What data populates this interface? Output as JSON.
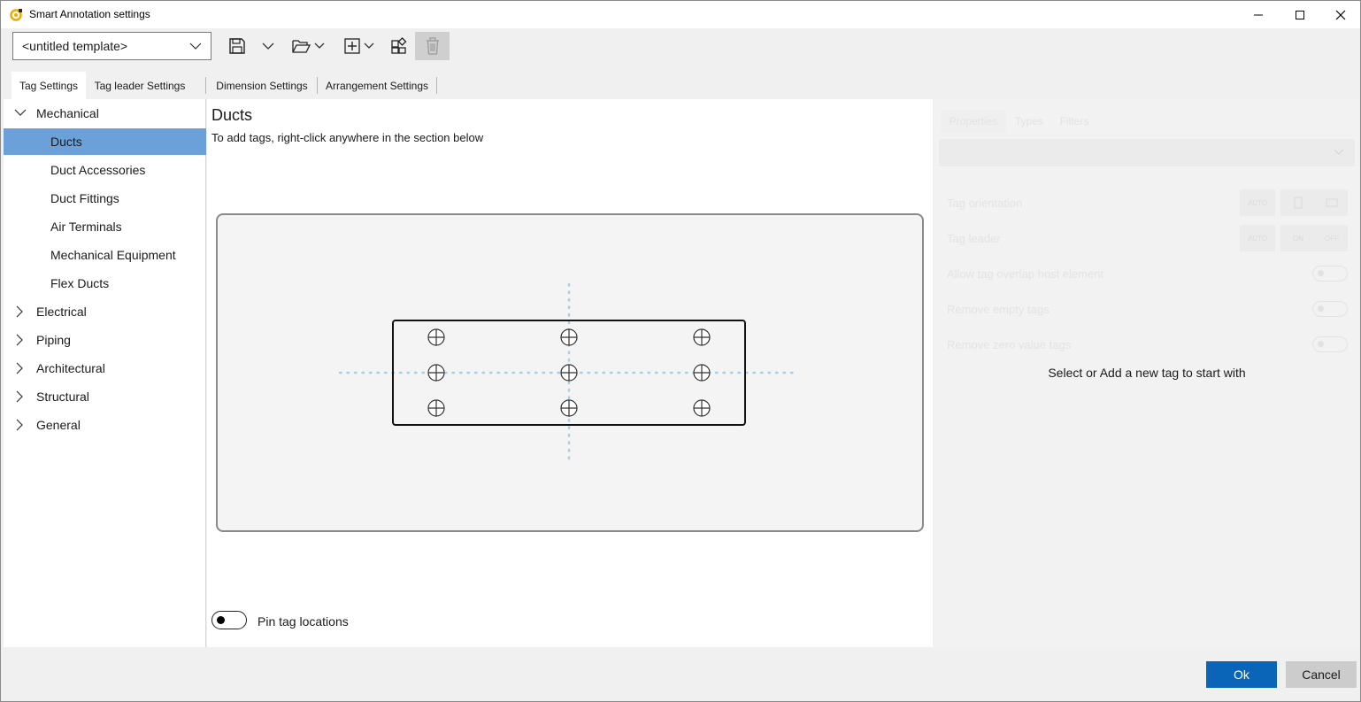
{
  "window": {
    "title": "Smart Annotation settings"
  },
  "toolbar": {
    "template_value": "<untitled template>"
  },
  "tabs": [
    {
      "label": "Tag Settings",
      "active": true
    },
    {
      "label": "Tag leader Settings",
      "active": false
    },
    {
      "label": "Dimension Settings",
      "active": false
    },
    {
      "label": "Arrangement Settings",
      "active": false
    }
  ],
  "tree": {
    "items": [
      {
        "label": "Mechanical",
        "expanded": true,
        "level": 0
      },
      {
        "label": "Ducts",
        "selected": true,
        "level": 1
      },
      {
        "label": "Duct Accessories",
        "level": 1
      },
      {
        "label": "Duct Fittings",
        "level": 1
      },
      {
        "label": "Air Terminals",
        "level": 1
      },
      {
        "label": "Mechanical Equipment",
        "level": 1
      },
      {
        "label": "Flex Ducts",
        "level": 1
      },
      {
        "label": "Electrical",
        "expanded": false,
        "level": 0
      },
      {
        "label": "Piping",
        "expanded": false,
        "level": 0
      },
      {
        "label": "Architectural",
        "expanded": false,
        "level": 0
      },
      {
        "label": "Structural",
        "expanded": false,
        "level": 0
      },
      {
        "label": "General",
        "expanded": false,
        "level": 0
      }
    ]
  },
  "main": {
    "title": "Ducts",
    "hint": "To add tags, right-click anywhere in the section below",
    "pin_label": "Pin tag locations",
    "pin_on": false
  },
  "properties": {
    "tabs": [
      "Properties",
      "Types",
      "Filters"
    ],
    "tag_orientation_label": "Tag orientation",
    "tag_leader_label": "Tag leader",
    "orientation_options": [
      "AUTO"
    ],
    "leader_options": [
      "AUTO",
      "ON",
      "OFF"
    ],
    "allow_overlap_label": "Allow tag overlap host element",
    "remove_empty_label": "Remove empty tags",
    "remove_zero_label": "Remove zero value tags",
    "empty_message": "Select or Add a new tag to start with"
  },
  "footer": {
    "ok_label": "Ok",
    "cancel_label": "Cancel"
  },
  "colors": {
    "accent": "#0a64b8",
    "selection": "#6ba1d8",
    "guide": "#a8cfe3"
  }
}
